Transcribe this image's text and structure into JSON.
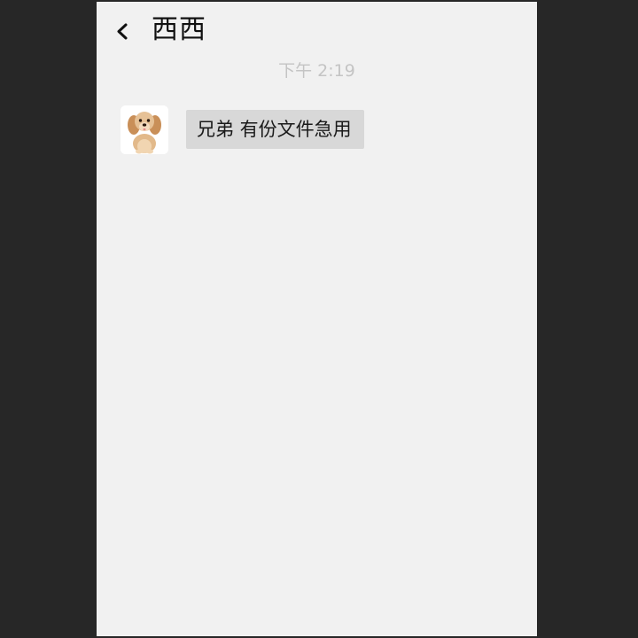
{
  "header": {
    "title": "西西",
    "back_icon": "chevron-left-icon"
  },
  "conversation": {
    "timestamp": "下午 2:19",
    "messages": [
      {
        "sender": "西西",
        "avatar_icon": "puppy-avatar",
        "text": "兄弟 有份文件急用"
      }
    ]
  },
  "colors": {
    "frame_background": "#272727",
    "chat_background": "#f1f1f1",
    "bubble_incoming": "#d8d8d8",
    "timestamp_text": "#c4c4c4"
  }
}
